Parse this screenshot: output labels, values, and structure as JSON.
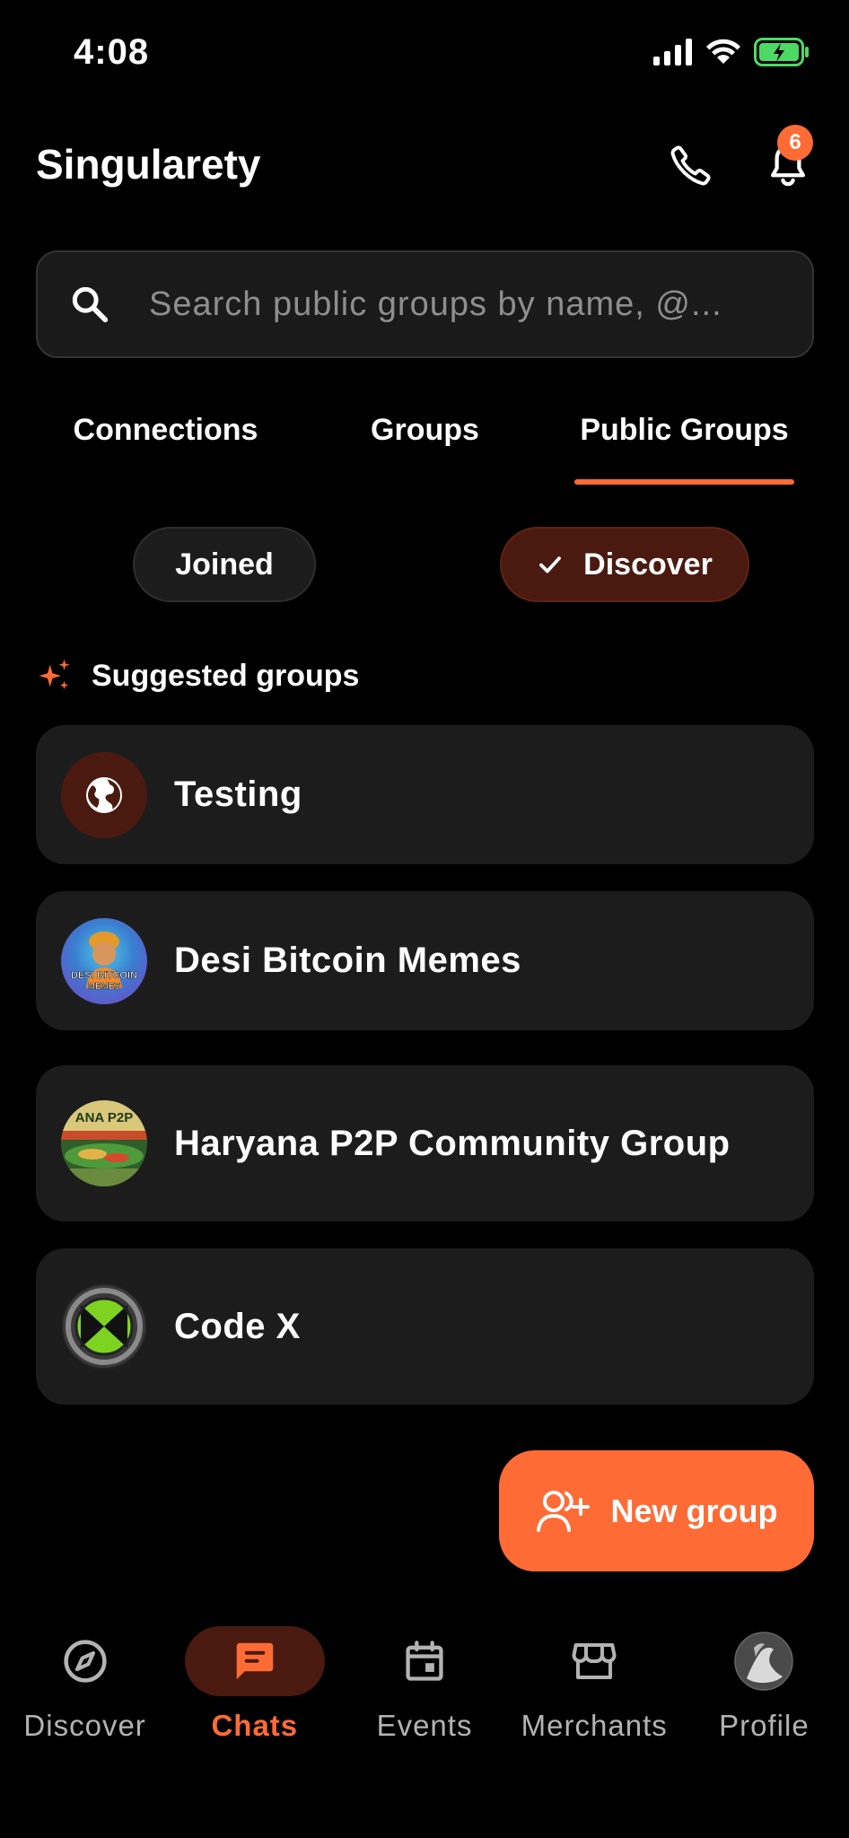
{
  "status_bar": {
    "time": "4:08"
  },
  "header": {
    "title": "Singularety",
    "notification_count": "6"
  },
  "search": {
    "placeholder": "Search public groups by name, @..."
  },
  "tabs": [
    {
      "label": "Connections"
    },
    {
      "label": "Groups"
    },
    {
      "label": "Public Groups"
    }
  ],
  "filters": {
    "joined": "Joined",
    "discover": "Discover"
  },
  "suggested": {
    "heading": "Suggested groups",
    "groups": [
      {
        "name": "Testing"
      },
      {
        "name": "Desi Bitcoin Memes",
        "avatar_text": "DESI BITCOIN MEMES"
      },
      {
        "name": "Haryana P2P Community Group",
        "avatar_text": "ANA P2P"
      },
      {
        "name": "Code X"
      }
    ]
  },
  "fab": {
    "label": "New group"
  },
  "nav": [
    {
      "label": "Discover",
      "icon": "compass-icon"
    },
    {
      "label": "Chats",
      "icon": "chat-bubble-icon"
    },
    {
      "label": "Events",
      "icon": "calendar-icon"
    },
    {
      "label": "Merchants",
      "icon": "storefront-icon"
    },
    {
      "label": "Profile",
      "icon": "profile-avatar"
    }
  ],
  "colors": {
    "accent": "#ff6b35",
    "accent_dark": "#4a1a10",
    "card": "#1c1c1c",
    "background": "#000000"
  }
}
